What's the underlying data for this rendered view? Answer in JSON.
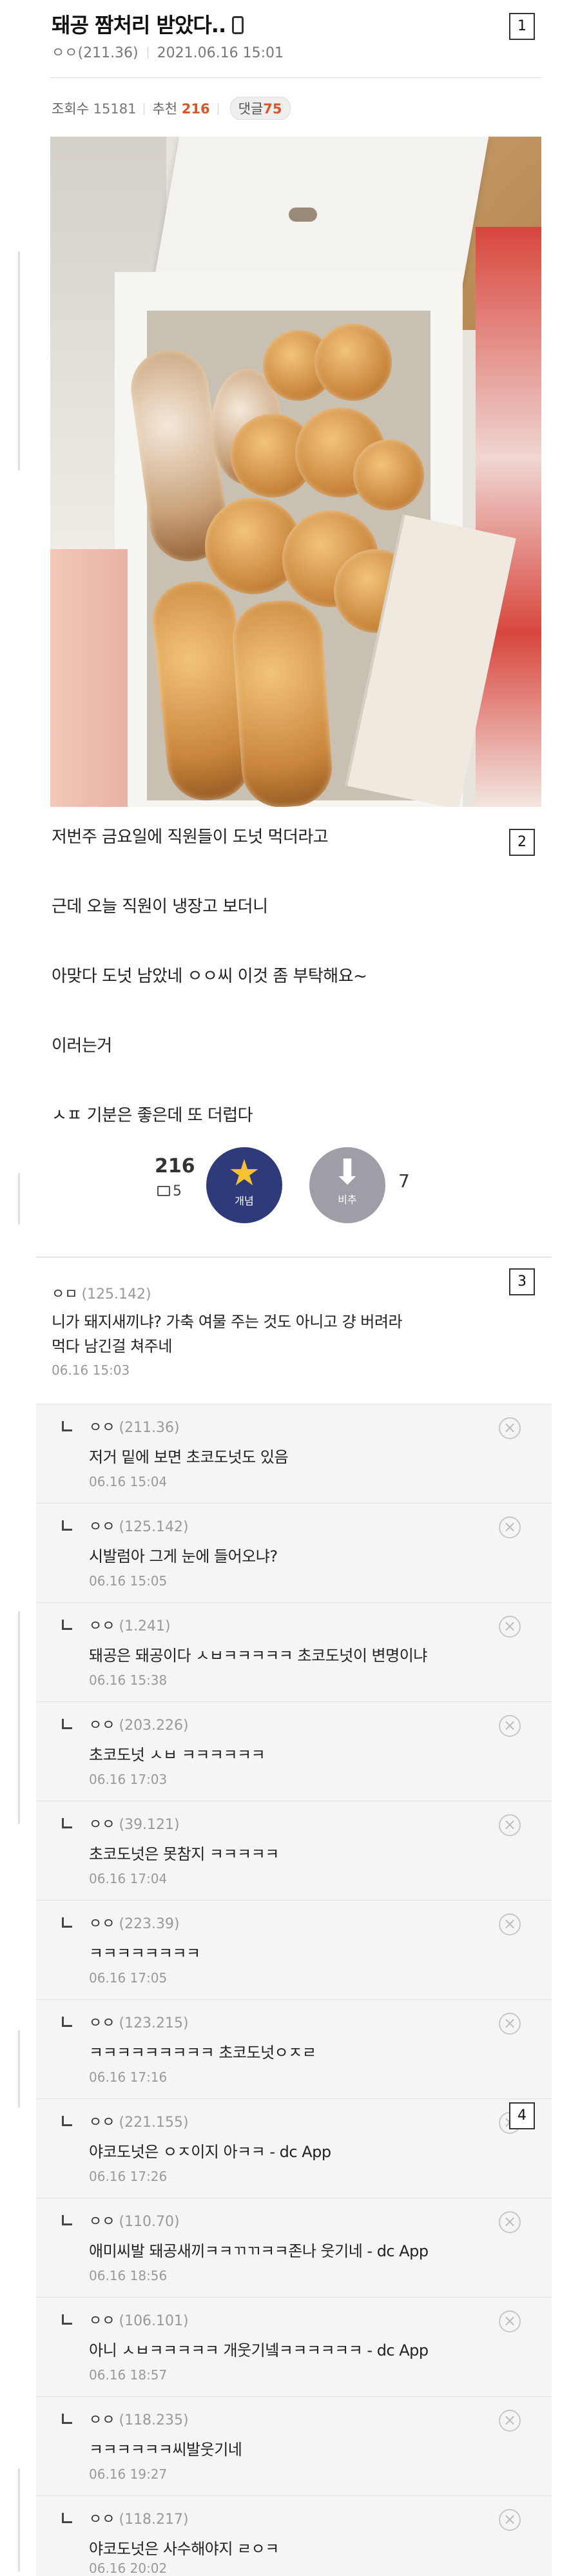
{
  "post": {
    "title": "돼공 짬처리 받았다..",
    "author": "ㅇㅇ(211.36)",
    "datetime": "2021.06.16 15:01",
    "views_label": "조회수",
    "views": "15181",
    "recommend_label": "추천",
    "recommend": "216",
    "comments_label": "댓글",
    "comments": "75",
    "body": [
      "저번주 금요일에 직원들이 도넛 먹더라고",
      "근데 오늘 직원이 냉장고 보더니",
      "아맞다 도넛 남았네 ㅇㅇ씨 이것 좀 부탁해요~",
      "이러는거",
      "ㅅㅍ 기분은 좋은데 또 더럽다"
    ]
  },
  "markers": [
    "1",
    "2",
    "3",
    "4"
  ],
  "vote": {
    "up_count": "216",
    "comment_count": "5",
    "up_label": "개념",
    "down_label": "비추",
    "down_count": "7"
  },
  "top_comment": {
    "nick": "ㅇㅁ",
    "ip": "(125.142)",
    "text_line1": "니가 돼지새끼냐? 가축 여물 주는 것도 아니고 걍 버려라",
    "text_line2": "먹다 남긴걸 쳐주네",
    "date": "06.16 15:03"
  },
  "replies": [
    {
      "nick": "ㅇㅇ",
      "ip": "(211.36)",
      "text": "저거 밑에 보면 초코도넛도 있음",
      "date": "06.16 15:04"
    },
    {
      "nick": "ㅇㅇ",
      "ip": "(125.142)",
      "text": "시발럼아 그게 눈에 들어오냐?",
      "date": "06.16 15:05"
    },
    {
      "nick": "ㅇㅇ",
      "ip": "(1.241)",
      "text": "돼공은 돼공이다 ㅅㅂㅋㅋㅋㅋㅋ 초코도넛이 변명이냐",
      "date": "06.16 15:38"
    },
    {
      "nick": "ㅇㅇ",
      "ip": "(203.226)",
      "text": "초코도넛 ㅅㅂ ㅋㅋㅋㅋㅋㅋ",
      "date": "06.16 17:03"
    },
    {
      "nick": "ㅇㅇ",
      "ip": "(39.121)",
      "text": "초코도넛은 못참지 ㅋㅋㅋㅋㅋ",
      "date": "06.16 17:04"
    },
    {
      "nick": "ㅇㅇ",
      "ip": "(223.39)",
      "text": "ㅋㅋㅋㅋㅋㅋㅋㅋ",
      "date": "06.16 17:05"
    },
    {
      "nick": "ㅇㅇ",
      "ip": "(123.215)",
      "text": "ㅋㅋㅋㅋㅋㅋㅋㅋㅋ 초코도넛ㅇㅈㄹ",
      "date": "06.16 17:16"
    },
    {
      "nick": "ㅇㅇ",
      "ip": "(221.155)",
      "text": "야코도넛은 ㅇㅈ이지 아ㅋㅋ - dc App",
      "date": "06.16 17:26"
    },
    {
      "nick": "ㅇㅇ",
      "ip": "(110.70)",
      "text": "애미씨발 돼공새끼ㅋㅋㄲㄲㅋㅋ존나 웃기네 - dc App",
      "date": "06.16 18:56"
    },
    {
      "nick": "ㅇㅇ",
      "ip": "(106.101)",
      "text": "아니 ㅅㅂㅋㅋㅋㅋㅋ 개웃기넼ㅋㅋㅋㅋㅋㅋ - dc App",
      "date": "06.16 18:57"
    },
    {
      "nick": "ㅇㅇ",
      "ip": "(118.235)",
      "text": "ㅋㅋㅋㅋㅋㅋ씨발웃기네",
      "date": "06.16 19:27"
    },
    {
      "nick": "ㅇㅇ",
      "ip": "(118.217)",
      "text": "야코도넛은 사수해야지 ㄹㅇㅋ",
      "date": "06.16 20:02"
    }
  ],
  "colors": {
    "accent": "#d8562c",
    "vote_up": "#2f3a7a",
    "vote_down": "#9e9fa6",
    "star": "#f6c233"
  }
}
